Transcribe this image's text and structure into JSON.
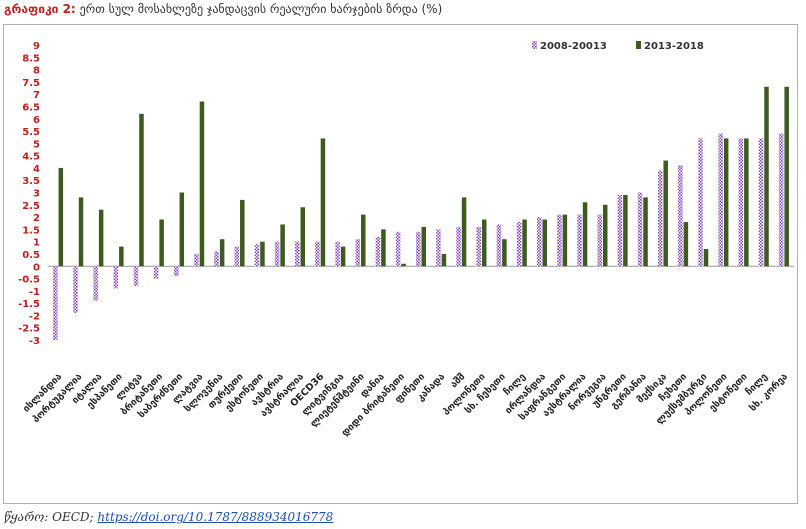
{
  "title": {
    "label": "გრაფიკი 2:",
    "text": "ერთ სულ მოსახლეზე ჯანდაცვის რეალური ხარჯების ზრდა (%)"
  },
  "source": {
    "label": "წყარო:",
    "org": "OECD;",
    "link": "https://doi.org/10.1787/888934016778"
  },
  "colors": {
    "series1": "#8a3dc9",
    "series2": "#3d5a1f",
    "axis_labels": "#c0201e"
  },
  "chart_data": {
    "type": "bar",
    "ylim": [
      -3,
      9
    ],
    "yticks": [
      "-3",
      "-2.5",
      "-2",
      "-1.5",
      "-1",
      "-0.5",
      "0",
      "0.5",
      "1",
      "1.5",
      "2",
      "2.5",
      "3",
      "3.5",
      "4",
      "4.5",
      "5",
      "5.5",
      "6",
      "6.5",
      "7",
      "7.5",
      "8",
      "8.5",
      "9"
    ],
    "grid": false,
    "legend_position": "top-right",
    "categories": [
      "ისლანდია",
      "პორტუგალია",
      "იტალია",
      "ესპანეთი",
      "ლიტვა",
      "ბრიტანეთი",
      "საბერძნეთი",
      "ლატვია",
      "სლოვენია",
      "თურქეთი",
      "ესტონეთი",
      "ავსტრია",
      "ავსტრალია",
      "OECD36",
      "ლიტვინგია",
      "ლიეტენშტეინი",
      "დანია",
      "დიდი ბრიტანეთი",
      "ფინეთი",
      "კანადა",
      "აშშ",
      "პოლონეთი",
      "სხ. ჩეხეთი",
      "ჩილე",
      "ირლანდია",
      "საფრანგეთი",
      "ავსტრალია",
      "ნორვეგია",
      "უნგრეთი",
      "გერმანია",
      "მექსიკა",
      "ჩეხეთი",
      "ლუქსემბურგი",
      "პოლონეთი",
      "ესტონეთი",
      "ჩილე",
      "სხ. კორეა"
    ],
    "series": [
      {
        "name": "2008-20013",
        "values": [
          -3.0,
          -1.9,
          -1.4,
          -0.9,
          -0.8,
          -0.5,
          -0.4,
          0.5,
          0.6,
          0.8,
          0.9,
          1.0,
          1.0,
          1.0,
          1.0,
          1.1,
          1.2,
          1.4,
          1.4,
          1.5,
          1.6,
          1.6,
          1.7,
          1.8,
          2.0,
          2.1,
          2.1,
          2.1,
          2.9,
          3.0,
          3.9,
          4.1,
          5.2,
          5.4,
          5.2,
          5.2,
          5.4
        ]
      },
      {
        "name": "2013-2018",
        "values": [
          4.0,
          2.8,
          2.3,
          0.8,
          6.2,
          1.9,
          3.0,
          6.7,
          1.1,
          2.7,
          1.0,
          1.7,
          2.4,
          5.2,
          0.8,
          2.1,
          1.5,
          0.1,
          1.6,
          0.5,
          2.8,
          1.9,
          1.1,
          1.9,
          1.9,
          2.1,
          2.6,
          2.5,
          2.9,
          2.8,
          4.3,
          1.8,
          0.7,
          5.2,
          5.2,
          7.3,
          7.3
        ]
      }
    ]
  }
}
